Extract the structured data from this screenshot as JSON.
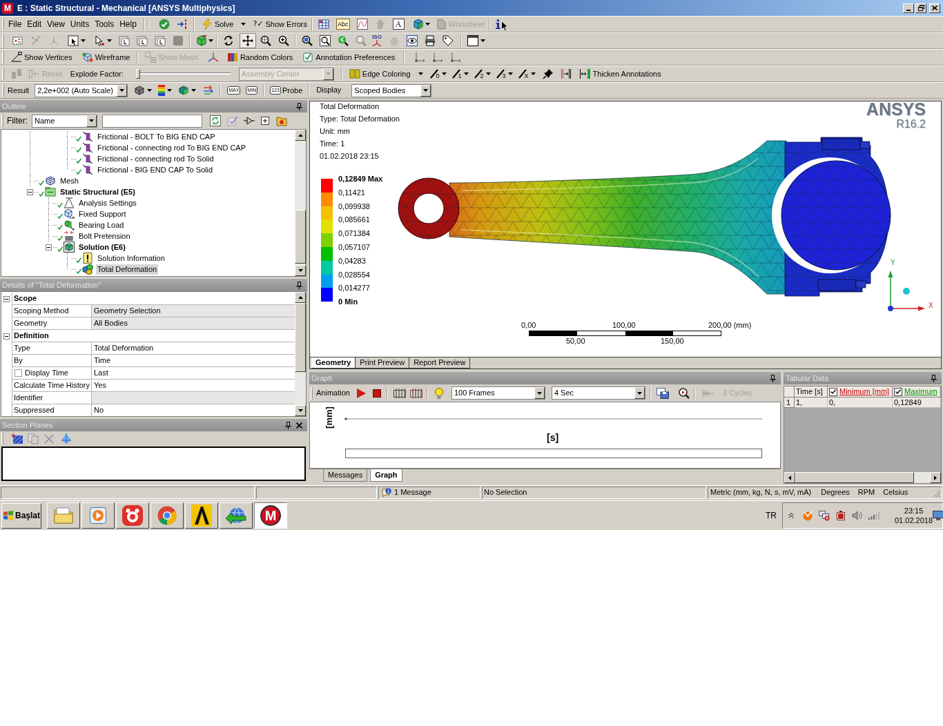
{
  "window": {
    "logo": "M",
    "title": "E : Static Structural - Mechanical [ANSYS Multiphysics]"
  },
  "toolbar_main": {
    "menu": [
      "File",
      "Edit",
      "View",
      "Units",
      "Tools",
      "Help"
    ],
    "solve": {
      "label": "Solve",
      "disabled": false
    },
    "show_errors": {
      "glyph": "?✓",
      "label": "Show Errors",
      "disabled": false
    },
    "icon_texts": [
      "Abc",
      "A"
    ],
    "worksheet": {
      "label": "Worksheet",
      "disabled": true
    }
  },
  "toolbar_graphics": {
    "icon_texts": [
      "ISO"
    ]
  },
  "toolbar_display": {
    "buttons": [
      {
        "kind": "vertices",
        "label": "Show Vertices",
        "disabled": false
      },
      {
        "kind": "wireframe",
        "label": "Wireframe",
        "disabled": false
      },
      {
        "kind": "mesh",
        "label": "Show Mesh",
        "disabled": true
      },
      {
        "kind": "random_colors",
        "label": "Random Colors",
        "disabled": false
      },
      {
        "kind": "annotation",
        "label": "Annotation Preferences",
        "disabled": false
      }
    ]
  },
  "toolbar_explode": {
    "reset": {
      "label": "Reset",
      "disabled": true
    },
    "explode_factor": {
      "label": "Explode Factor:",
      "level": 0
    },
    "center": {
      "value": "Assembly Center",
      "disabled": true
    },
    "edge_coloring": "Edge Coloring",
    "edge_icons": [
      "0",
      "1",
      "2",
      "3",
      "X"
    ],
    "thicken": "Thicken Annotations"
  },
  "toolbar_result": {
    "label": "Result",
    "scale": "2,2e+002 (Auto Scale)",
    "max": "MAX",
    "min": "MIN",
    "probe": {
      "badge": "123",
      "label": "Probe"
    },
    "display": {
      "label": "Display",
      "value": "Scoped Bodies"
    }
  },
  "outline": {
    "title": "Outline",
    "filter": {
      "label": "Filter:",
      "value": "Name"
    },
    "tree": [
      {
        "children": [
          {
            "children": [
              {
                "label": "Frictional - BOLT To BIG END CAP",
                "kind": "contact",
                "solved": true,
                "selected": false
              },
              {
                "label": "Frictional - connecting rod To BIG END CAP",
                "kind": "contact",
                "solved": true,
                "selected": false
              },
              {
                "label": "Frictional - connecting rod To Solid",
                "kind": "contact",
                "solved": true,
                "selected": false
              },
              {
                "label": "Frictional - BIG END CAP To Solid",
                "kind": "contact",
                "solved": true,
                "selected": false
              }
            ]
          }
        ]
      },
      {
        "label": "Mesh",
        "kind": "mesh",
        "solved": true,
        "selected": false
      },
      {
        "label": "Static Structural (E5)",
        "kind": "environment",
        "solved": true,
        "selected": false,
        "expanded": true,
        "children": [
          {
            "label": "Analysis Settings",
            "kind": "analysis_settings",
            "solved": true,
            "selected": false
          },
          {
            "label": "Fixed Support",
            "kind": "fixed_support",
            "solved": true,
            "selected": false
          },
          {
            "label": "Bearing Load",
            "kind": "bearing_load",
            "solved": true,
            "selected": false
          },
          {
            "label": "Bolt Pretension",
            "kind": "bolt_pretension",
            "solved": true,
            "selected": false
          },
          {
            "label": "Solution (E6)",
            "kind": "solution",
            "solved": true,
            "selected": false,
            "expanded": true,
            "children": [
              {
                "label": "Solution Information",
                "kind": "solution_info",
                "solved": true,
                "selected": false
              },
              {
                "label": "Total Deformation",
                "kind": "result",
                "solved": true,
                "selected": true
              }
            ]
          }
        ]
      }
    ]
  },
  "details": {
    "title": "Details of \"Total Deformation\"",
    "groups": [
      {
        "label": "Scope",
        "expanded": true,
        "rows": [
          {
            "kind": "text",
            "name": "Scoping Method",
            "value": "Geometry Selection",
            "readonly": true
          },
          {
            "kind": "text",
            "name": "Geometry",
            "value": "All Bodies",
            "readonly": true
          }
        ]
      },
      {
        "label": "Definition",
        "expanded": true,
        "rows": [
          {
            "kind": "text",
            "name": "Type",
            "value": "Total Deformation",
            "readonly": false
          },
          {
            "kind": "text",
            "name": "By",
            "value": "Time",
            "readonly": false
          },
          {
            "kind": "checkbox",
            "name": "Display Time",
            "checked": false,
            "value": "Last",
            "readonly": false
          },
          {
            "kind": "text",
            "name": "Calculate Time History",
            "value": "Yes",
            "readonly": false
          },
          {
            "kind": "text",
            "name": "Identifier",
            "readonly": true
          },
          {
            "kind": "text",
            "name": "Suppressed",
            "value": "No",
            "readonly": false
          }
        ]
      }
    ]
  },
  "section_planes": {
    "title": "Section Planes"
  },
  "viewport": {
    "result_info": [
      "Total Deformation",
      "Type: Total Deformation",
      "Unit: mm",
      "Time: 1",
      "01.02.2018 23:15"
    ],
    "logo": {
      "name": "ANSYS",
      "version": "R16.2"
    },
    "legend": {
      "bands": [
        {
          "color": "#ff0000"
        },
        {
          "color": "#ff8c00"
        },
        {
          "color": "#f2c200"
        },
        {
          "color": "#e1e100"
        },
        {
          "color": "#80d000"
        },
        {
          "color": "#00c000"
        },
        {
          "color": "#00c8a0"
        },
        {
          "color": "#00a0f0"
        },
        {
          "color": "#0000ff"
        }
      ],
      "labels": [
        {
          "text": "0,12849 Max",
          "kind": "max"
        },
        {
          "text": "0,11421",
          "kind": "value"
        },
        {
          "text": "0,099938",
          "kind": "value"
        },
        {
          "text": "0,085661",
          "kind": "value"
        },
        {
          "text": "0,071384",
          "kind": "value"
        },
        {
          "text": "0,057107",
          "kind": "value"
        },
        {
          "text": "0,04283",
          "kind": "value"
        },
        {
          "text": "0,028554",
          "kind": "value"
        },
        {
          "text": "0,014277",
          "kind": "value"
        },
        {
          "text": "0 Min",
          "kind": "min"
        }
      ]
    },
    "scale_bar": {
      "top_labels": [
        "0,00",
        "100,00",
        "200,00 (mm)"
      ],
      "bottom_labels": [
        "50,00",
        "150,00"
      ]
    },
    "triad": {
      "x_label": "X",
      "y_label": "Y"
    }
  },
  "view_tabs": [
    {
      "label": "Geometry",
      "selected": true
    },
    {
      "label": "Print Preview",
      "selected": false
    },
    {
      "label": "Report Preview",
      "selected": false
    }
  ],
  "graph": {
    "title": "Graph",
    "toolbar": {
      "label": "Animation",
      "frames": "100 Frames",
      "duration": "4 Sec",
      "cycles": {
        "label": "3 Cycles",
        "disabled": true
      }
    },
    "ylabel": "[mm]",
    "xlabel": "[s]",
    "tabs": [
      {
        "label": "Messages",
        "selected": false
      },
      {
        "label": "Graph",
        "selected": true
      }
    ]
  },
  "tabular": {
    "title": "Tabular Data",
    "columns": [
      {
        "kind": "axis",
        "label": "Time [s]"
      },
      {
        "kind": "series",
        "label": "Minimum [mm]",
        "checked": true,
        "color": "#cc0000"
      },
      {
        "kind": "series",
        "label": "Maximum",
        "checked": true,
        "color": "#009900"
      }
    ],
    "rows": [
      {
        "index": "1",
        "cells": [
          "1,",
          "0,",
          "0,12849"
        ]
      }
    ]
  },
  "status_bar": {
    "message": "1 Message",
    "selection": "No Selection",
    "units": "Metric (mm, kg, N, s, mV, mA)",
    "angle": "Degrees",
    "rotation": "RPM",
    "temperature": "Celsius"
  },
  "taskbar": {
    "start": "Başlat",
    "apps": [
      {
        "kind": "explorer",
        "selected": false
      },
      {
        "kind": "media",
        "selected": false
      },
      {
        "kind": "red_app",
        "selected": false
      },
      {
        "kind": "browser",
        "selected": false
      },
      {
        "kind": "triangle",
        "selected": false
      },
      {
        "kind": "downloader",
        "selected": false
      },
      {
        "kind": "mechanical",
        "glyph": "M",
        "selected": true
      }
    ],
    "language": "TR",
    "clock": {
      "time": "23:15",
      "date": "01.02.2018"
    }
  }
}
